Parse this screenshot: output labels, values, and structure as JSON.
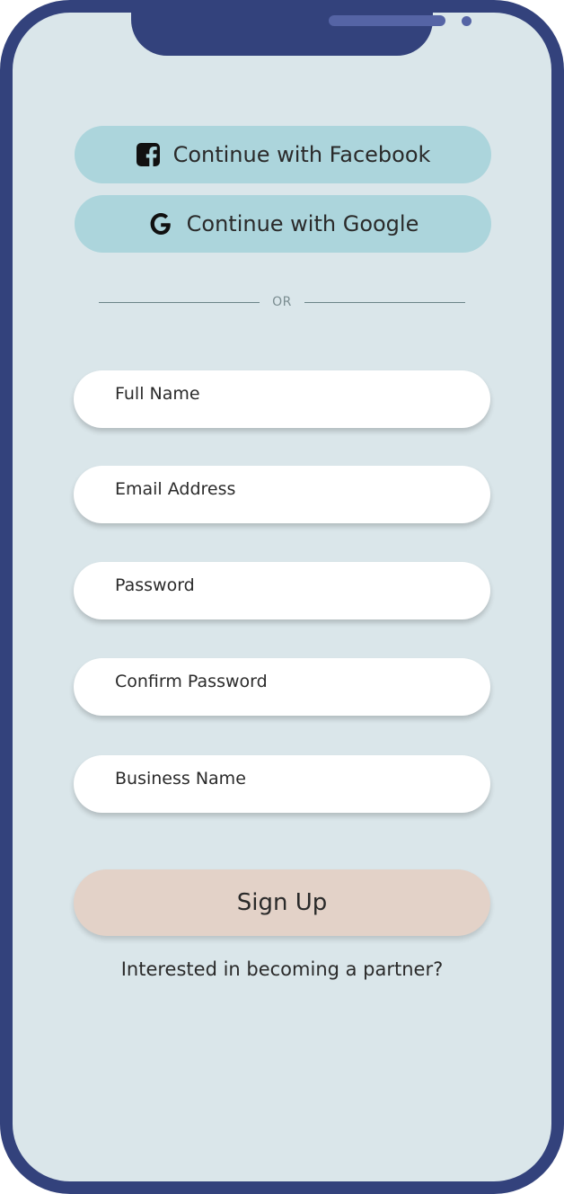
{
  "social": {
    "facebook": {
      "label": "Continue with Facebook",
      "icon": "facebook-icon"
    },
    "google": {
      "label": "Continue with Google",
      "icon": "google-icon"
    }
  },
  "divider": {
    "text": "OR"
  },
  "form": {
    "full_name": {
      "placeholder": "Full Name",
      "value": ""
    },
    "email": {
      "placeholder": "Email Address",
      "value": ""
    },
    "password": {
      "placeholder": "Password",
      "value": ""
    },
    "confirm_password": {
      "placeholder": "Confirm Password",
      "value": ""
    },
    "business_name": {
      "placeholder": "Business Name",
      "value": ""
    }
  },
  "signup_label": "Sign Up",
  "partner_link": "Interested in becoming a partner?",
  "colors": {
    "frame": "#33427c",
    "screen": "#dae6ea",
    "social_button": "#acd5dc",
    "signup_button": "#e3d2c8"
  }
}
